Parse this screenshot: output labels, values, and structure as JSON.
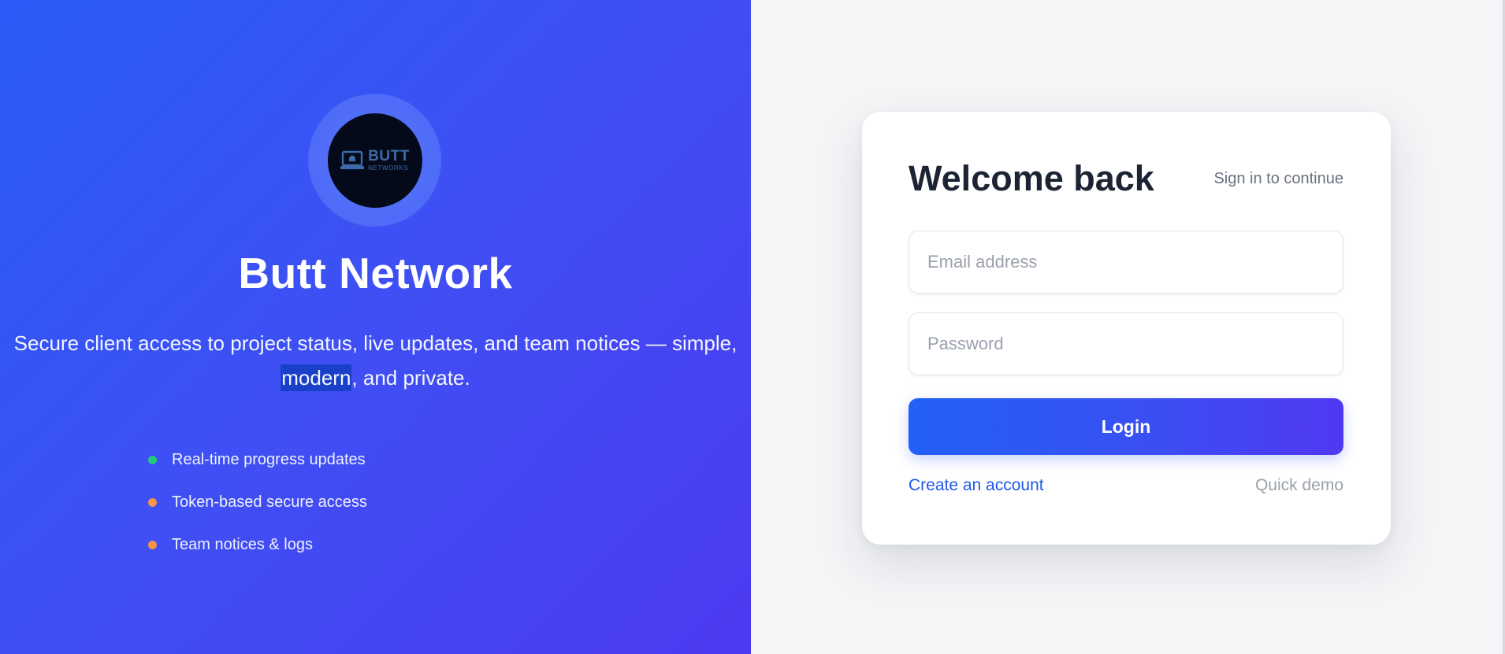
{
  "hero": {
    "logo": {
      "main": "BUTT",
      "sub": "NETWORKS",
      "icon": "laptop-icon"
    },
    "title": "Butt Network",
    "tagline": {
      "before": "Secure client access to project status, live updates, and team notices — simple, ",
      "highlight": "modern",
      "after": ", and private."
    },
    "features": [
      {
        "label": "Real-time progress updates",
        "dot_color": "#22c97a"
      },
      {
        "label": "Token-based secure access",
        "dot_color": "#f7944a"
      },
      {
        "label": "Team notices & logs",
        "dot_color": "#f7944a"
      }
    ]
  },
  "login": {
    "heading": "Welcome back",
    "subtitle": "Sign in to continue",
    "email_placeholder": "Email address",
    "password_placeholder": "Password",
    "submit_label": "Login",
    "create_account_label": "Create an account",
    "demo_label": "Quick demo"
  },
  "colors": {
    "accent": "#2160f7",
    "accent_end": "#5038f2",
    "link": "#1f58e8",
    "heading": "#1c2434"
  }
}
